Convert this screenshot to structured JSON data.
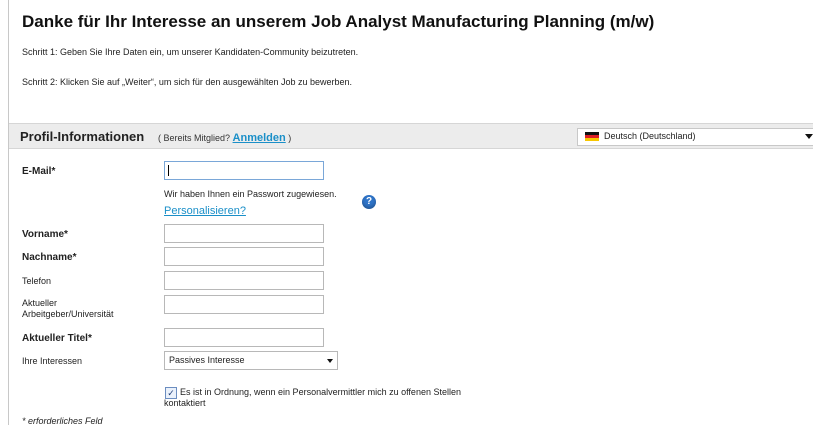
{
  "page": {
    "title": "Danke für Ihr Interesse an unserem Job Analyst Manufacturing Planning (m/w)",
    "step1": "Schritt 1: Geben Sie Ihre Daten ein, um unserer Kandidaten-Community beizutreten.",
    "step2": "Schritt 2: Klicken Sie auf „Weiter“, um sich für den ausgewählten Job zu bewerben."
  },
  "profile": {
    "title": "Profil-Informationen",
    "member_prefix": "( Bereits Mitglied?",
    "login_link": "Anmelden",
    "member_suffix": ")",
    "language": "Deutsch (Deutschland)"
  },
  "form": {
    "email_label": "E-Mail*",
    "email_value": "",
    "password_note": "Wir haben Ihnen ein Passwort zugewiesen.",
    "personalize_link": "Personalisieren?",
    "help_icon": "question-mark-icon",
    "firstname_label": "Vorname*",
    "lastname_label": "Nachname*",
    "phone_label": "Telefon",
    "employer_label_line1": "Aktueller",
    "employer_label_line2": "Arbeitgeber/Universität",
    "title_label": "Aktueller Titel*",
    "interests_label": "Ihre Interessen",
    "interests_value": "Passives Interesse",
    "consent_text": "Es ist in Ordnung, wenn ein Personalvermittler mich zu offenen Stellen kontaktiert",
    "consent_checked": true,
    "required_note": "* erforderliches Feld"
  },
  "colors": {
    "link": "#1a8fc8",
    "section_bar": "#ececec"
  }
}
